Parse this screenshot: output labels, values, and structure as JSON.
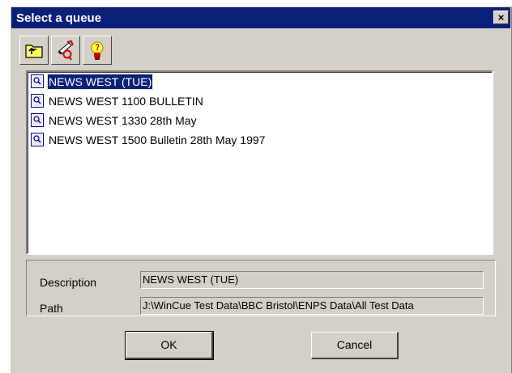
{
  "window": {
    "title": "Select a queue",
    "close_label": "×"
  },
  "toolbar": {
    "buttons": [
      {
        "icon": "folder-up-icon"
      },
      {
        "icon": "query-icon"
      },
      {
        "icon": "lightbulb-icon"
      }
    ]
  },
  "queues": [
    {
      "label": "NEWS WEST (TUE)",
      "selected": true
    },
    {
      "label": "NEWS WEST 1100 BULLETIN",
      "selected": false
    },
    {
      "label": "NEWS WEST 1330 28th May",
      "selected": false
    },
    {
      "label": "NEWS WEST 1500 Bulletin 28th May 1997",
      "selected": false
    }
  ],
  "details": {
    "description_label": "Description",
    "description_value": "NEWS WEST (TUE)",
    "path_label": "Path",
    "path_value": "J:\\WinCue Test Data\\BBC Bristol\\ENPS Data\\All Test Data"
  },
  "buttons": {
    "ok_label": "OK",
    "cancel_label": "Cancel"
  },
  "colors": {
    "titlebar": "#0a1f7a",
    "face": "#d4d0c8",
    "selection": "#0a1f7a"
  }
}
